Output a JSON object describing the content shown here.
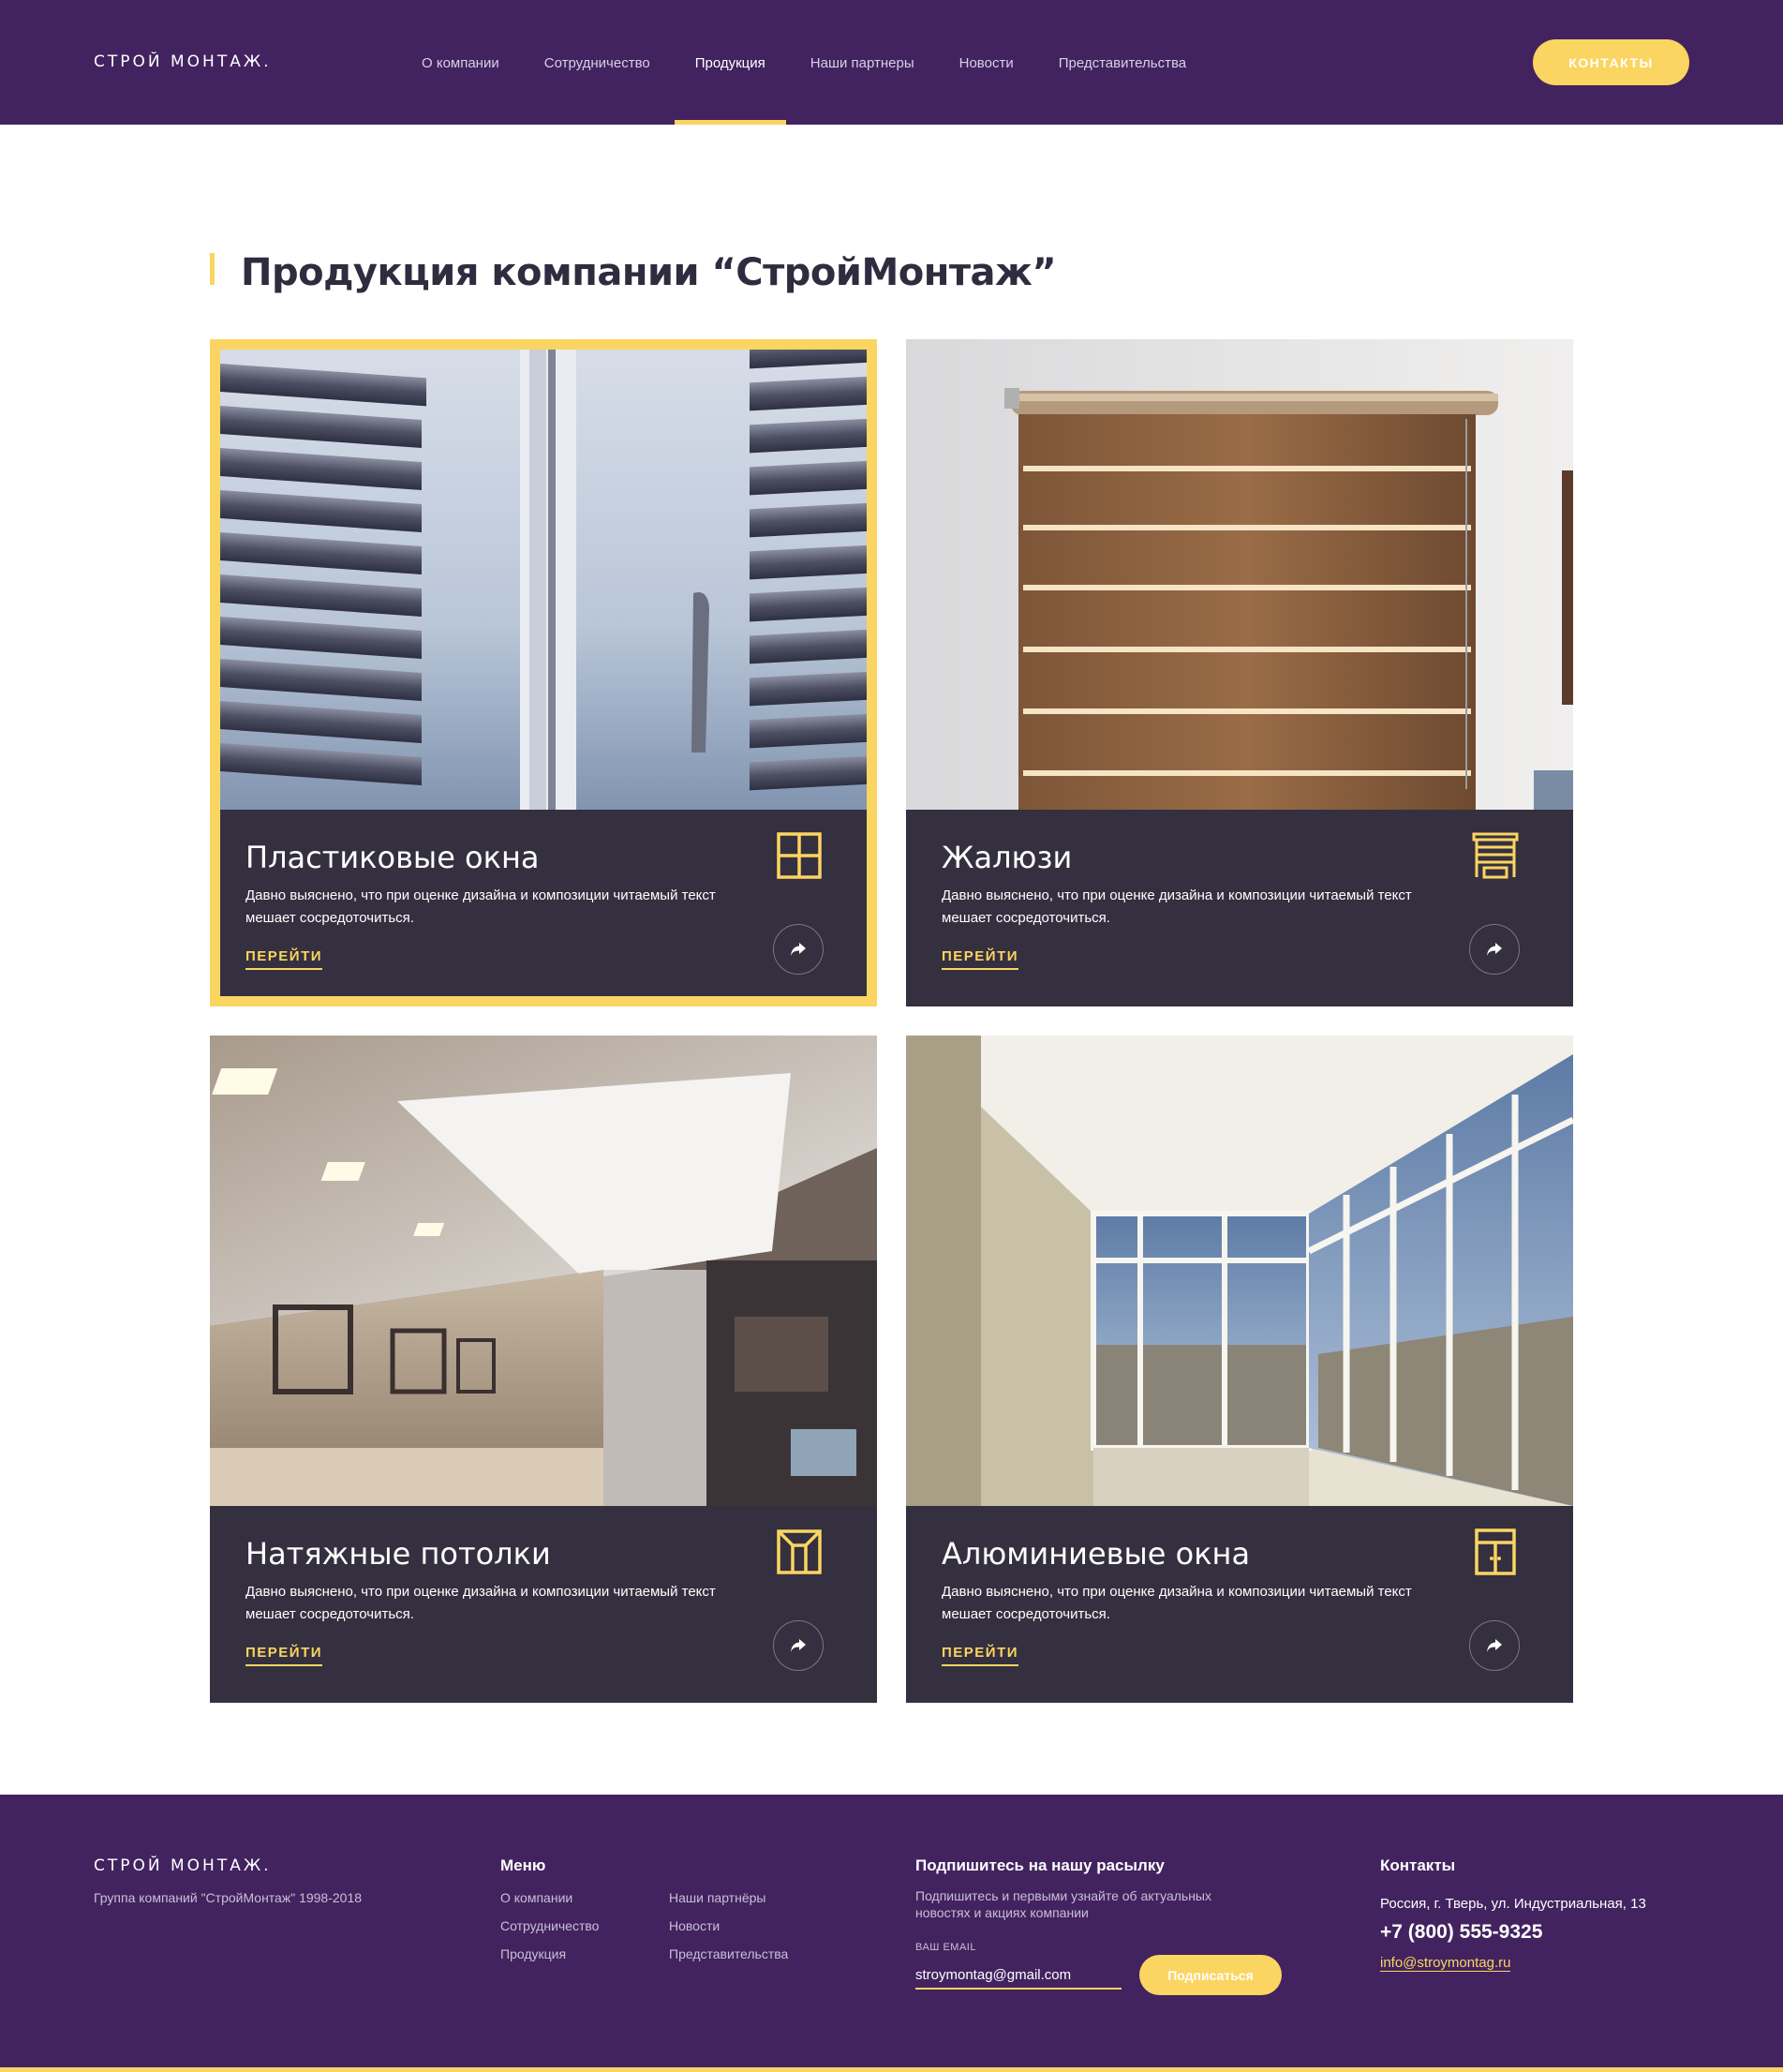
{
  "colors": {
    "primary": "#42235f",
    "accent": "#fbd561",
    "card_bg": "#35303f",
    "title": "#2e2c3f"
  },
  "header": {
    "logo": "СТРОЙ МОНТАЖ.",
    "nav": [
      {
        "label": "О компании",
        "active": false
      },
      {
        "label": "Сотрудничество",
        "active": false
      },
      {
        "label": "Продукция",
        "active": true
      },
      {
        "label": "Наши партнеры",
        "active": false
      },
      {
        "label": "Новости",
        "active": false
      },
      {
        "label": "Представительства",
        "active": false
      }
    ],
    "contacts_button": "КОНТАКТЫ"
  },
  "main": {
    "title": "Продукция компании “СтройМонтаж”",
    "cards": [
      {
        "title": "Пластиковые окна",
        "description": "Давно выяснено, что при оценке дизайна и композиции читаемый текст мешает сосредоточиться.",
        "link": "ПЕРЕЙТИ",
        "icon": "window-icon"
      },
      {
        "title": "Жалюзи",
        "description": "Давно выяснено, что при оценке дизайна и композиции читаемый текст мешает сосредоточиться.",
        "link": "ПЕРЕЙТИ",
        "icon": "blinds-icon"
      },
      {
        "title": "Натяжные потолки",
        "description": "Давно выяснено, что при оценке дизайна и композиции читаемый текст мешает сосредоточиться.",
        "link": "ПЕРЕЙТИ",
        "icon": "ceiling-icon"
      },
      {
        "title": "Алюминиевые окна",
        "description": "Давно выяснено, что при оценке дизайна и композиции читаемый текст мешает сосредоточиться.",
        "link": "ПЕРЕЙТИ",
        "icon": "door-window-icon"
      }
    ]
  },
  "footer": {
    "logo": "СТРОЙ МОНТАЖ.",
    "copyright": "Группа компаний \"СтройМонтаж\" 1998-2018",
    "menu_title": "Меню",
    "menu_col1": [
      "О компании",
      "Сотрудничество",
      "Продукция"
    ],
    "menu_col2": [
      "Наши партнёры",
      "Новости",
      "Представительства"
    ],
    "subscribe_title": "Подпишитесь на нашу расылку",
    "subscribe_text": "Подпишитесь и первыми узнайте об актуальных новостях и акциях компании",
    "email_label": "ВАШ EMAIL",
    "email_value": "stroymontag@gmail.com",
    "subscribe_button": "Подписаться",
    "contacts_title": "Контакты",
    "address": "Россия, г. Тверь, ул. Индустриальная, 13",
    "phone": "+7 (800) 555-9325",
    "email": "info@stroymontag.ru"
  }
}
